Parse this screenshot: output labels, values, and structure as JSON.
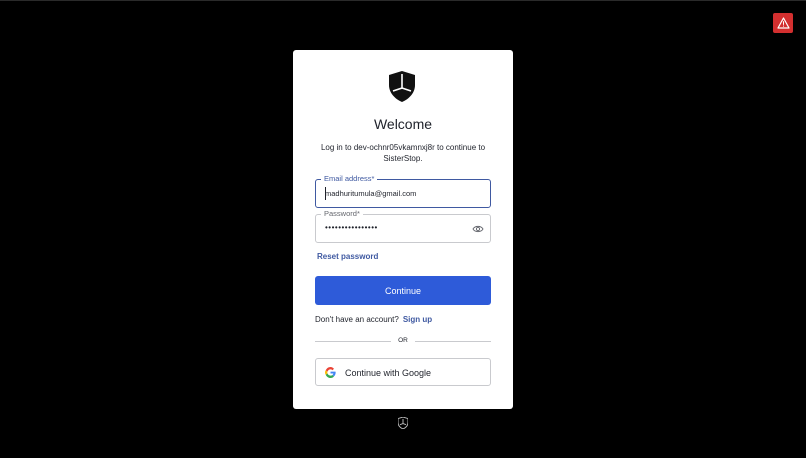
{
  "colors": {
    "background": "#000000",
    "card": "#ffffff",
    "primary": "#2e5bd9",
    "link": "#3f59a1",
    "warning": "#d32f2f"
  },
  "header": {
    "warning_icon": "warning-triangle-icon"
  },
  "login": {
    "logo_icon": "shield-logo-icon",
    "title": "Welcome",
    "subtitle": "Log in to dev-ochnr05vkamnxj8r to continue to SisterStop.",
    "email": {
      "label": "Email address",
      "required_mark": "*",
      "value": "madhuritumula@gmail.com"
    },
    "password": {
      "label": "Password",
      "required_mark": "*",
      "value": "••••••••••••••••",
      "toggle_icon": "eye-icon"
    },
    "reset_password": "Reset password",
    "continue_label": "Continue",
    "signup_prompt": "Don't have an account?",
    "signup_link": "Sign up",
    "divider": "OR",
    "google_label": "Continue with Google",
    "google_icon": "google-icon"
  },
  "footer": {
    "logo_icon": "shield-logo-icon"
  }
}
